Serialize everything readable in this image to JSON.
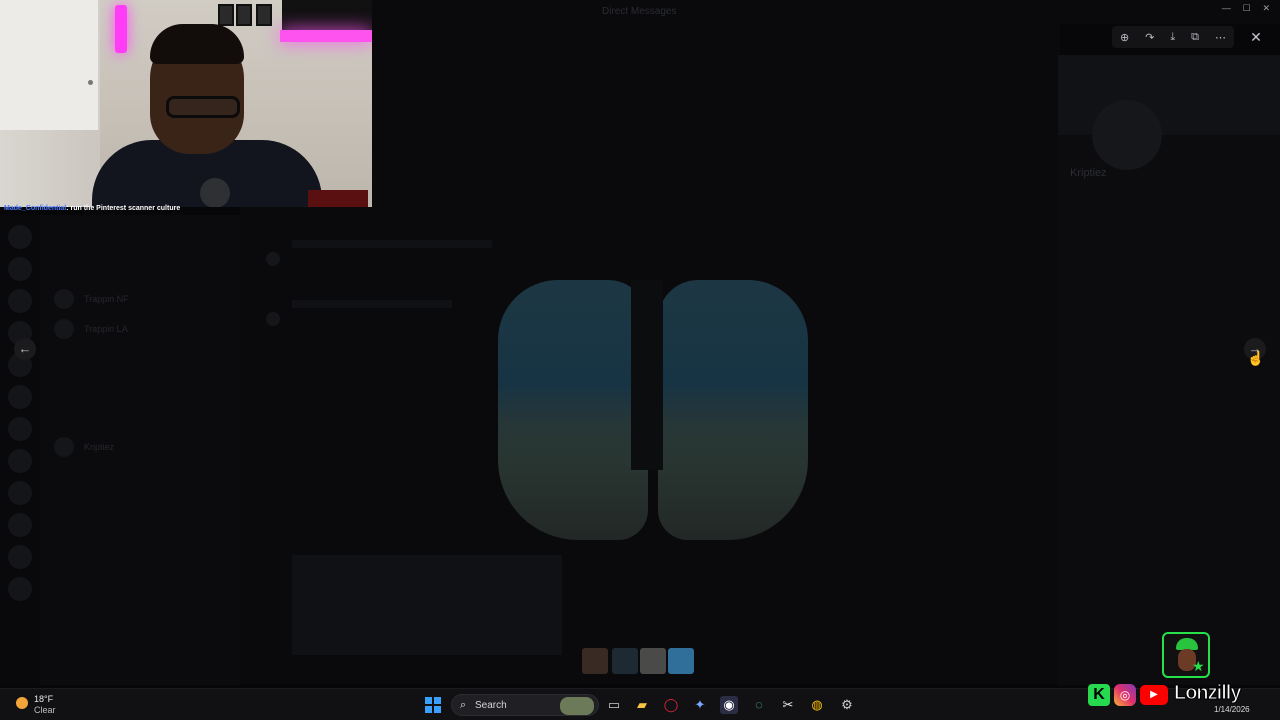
{
  "stream_chat": {
    "username": "Made_Confidential",
    "message": ": run the Pinterest scanner culture"
  },
  "app": {
    "window_title": "Direct Messages"
  },
  "viewer": {
    "tools": [
      {
        "icon": "zoom-in-icon",
        "glyph": "⊕"
      },
      {
        "icon": "rotate-icon",
        "glyph": "↷"
      },
      {
        "icon": "download-icon",
        "glyph": "⤓"
      },
      {
        "icon": "open-external-icon",
        "glyph": "⧉"
      },
      {
        "icon": "more-icon",
        "glyph": "⋯"
      }
    ],
    "close_glyph": "✕",
    "prev_glyph": "←",
    "next_glyph": "→"
  },
  "dm_list": [
    {
      "name": "Trappin NF"
    },
    {
      "name": "Trappin LA"
    },
    {
      "name": "Kriptiez"
    }
  ],
  "profile": {
    "name": "Kriptiez"
  },
  "colors": {
    "accent_green": "#27e04a",
    "led_pink": "#ff3df7",
    "taskbar_bg": "#111113"
  },
  "taskbar": {
    "weather_temp": "18°F",
    "weather_condition": "Clear",
    "search_placeholder": "Search",
    "date": "1/14/2026"
  },
  "overlay": {
    "brand_letter": "K",
    "channel_name": "Lonzilly"
  }
}
